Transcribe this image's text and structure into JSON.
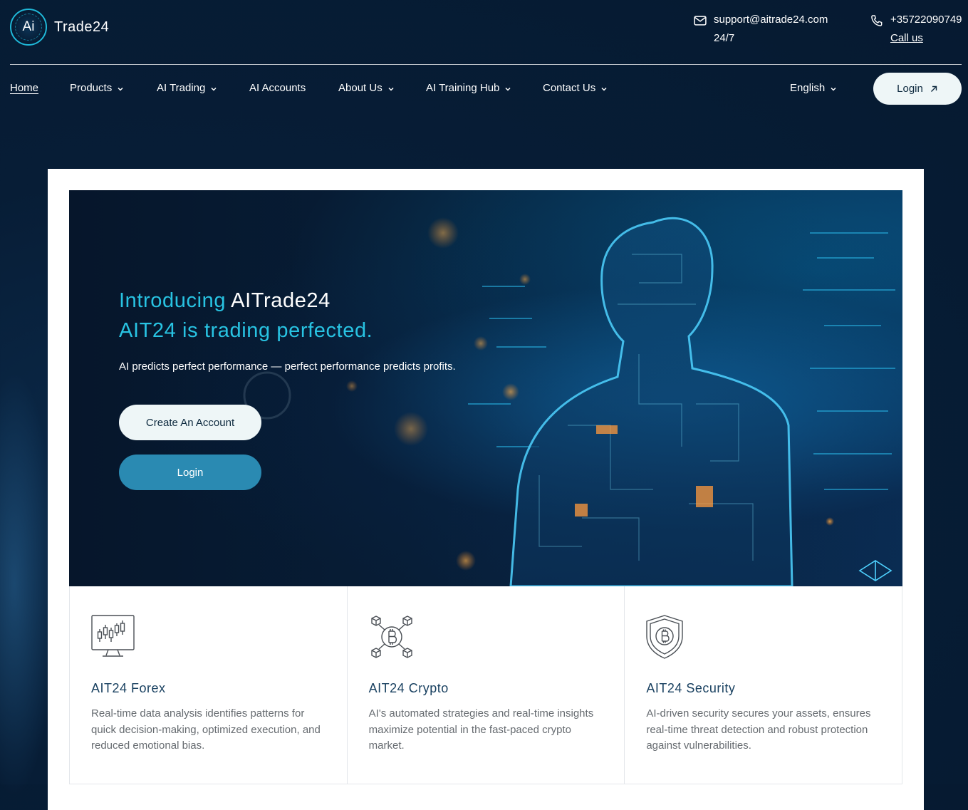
{
  "brand": {
    "logo_mark": "Ai",
    "name": "Trade24"
  },
  "contact": {
    "email": "support@aitrade24.com",
    "email_note": "24/7",
    "email_icon": "mail-icon",
    "phone": "+35722090749",
    "phone_link": "Call us",
    "phone_icon": "phone-icon"
  },
  "nav": {
    "items": [
      {
        "label": "Home",
        "dropdown": false,
        "active": true
      },
      {
        "label": "Products",
        "dropdown": true
      },
      {
        "label": "AI Trading",
        "dropdown": true
      },
      {
        "label": "AI Accounts",
        "dropdown": false
      },
      {
        "label": "About Us",
        "dropdown": true
      },
      {
        "label": "AI Training Hub",
        "dropdown": true
      },
      {
        "label": "Contact Us",
        "dropdown": true
      }
    ],
    "language": "English",
    "login_label": "Login"
  },
  "hero": {
    "title_line1_prefix": "Introducing ",
    "title_line1_brand": "AITrade24",
    "title_line2": "AIT24 is trading perfected.",
    "subtitle": "AI predicts perfect performance — perfect performance predicts profits.",
    "create_account_label": "Create An Account",
    "login_label": "Login"
  },
  "features": [
    {
      "icon": "candlestick-monitor-icon",
      "title": "AIT24 Forex",
      "description": "Real-time data analysis identifies patterns for quick decision-making, optimized execution, and reduced emotional bias."
    },
    {
      "icon": "bitcoin-network-icon",
      "title": "AIT24 Crypto",
      "description": "AI's automated strategies and real-time insights maximize potential in the fast-paced crypto market."
    },
    {
      "icon": "bitcoin-shield-icon",
      "title": "AIT24 Security",
      "description": "AI-driven security secures your assets, ensures real-time threat detection and robust protection against vulnerabilities."
    }
  ],
  "colors": {
    "page_bg": "#061a31",
    "accent_cyan": "#28c3e2",
    "button_blue": "#2a8ab2",
    "button_light": "#eef6f7",
    "feature_title": "#173f5f",
    "feature_text": "#666b70"
  }
}
